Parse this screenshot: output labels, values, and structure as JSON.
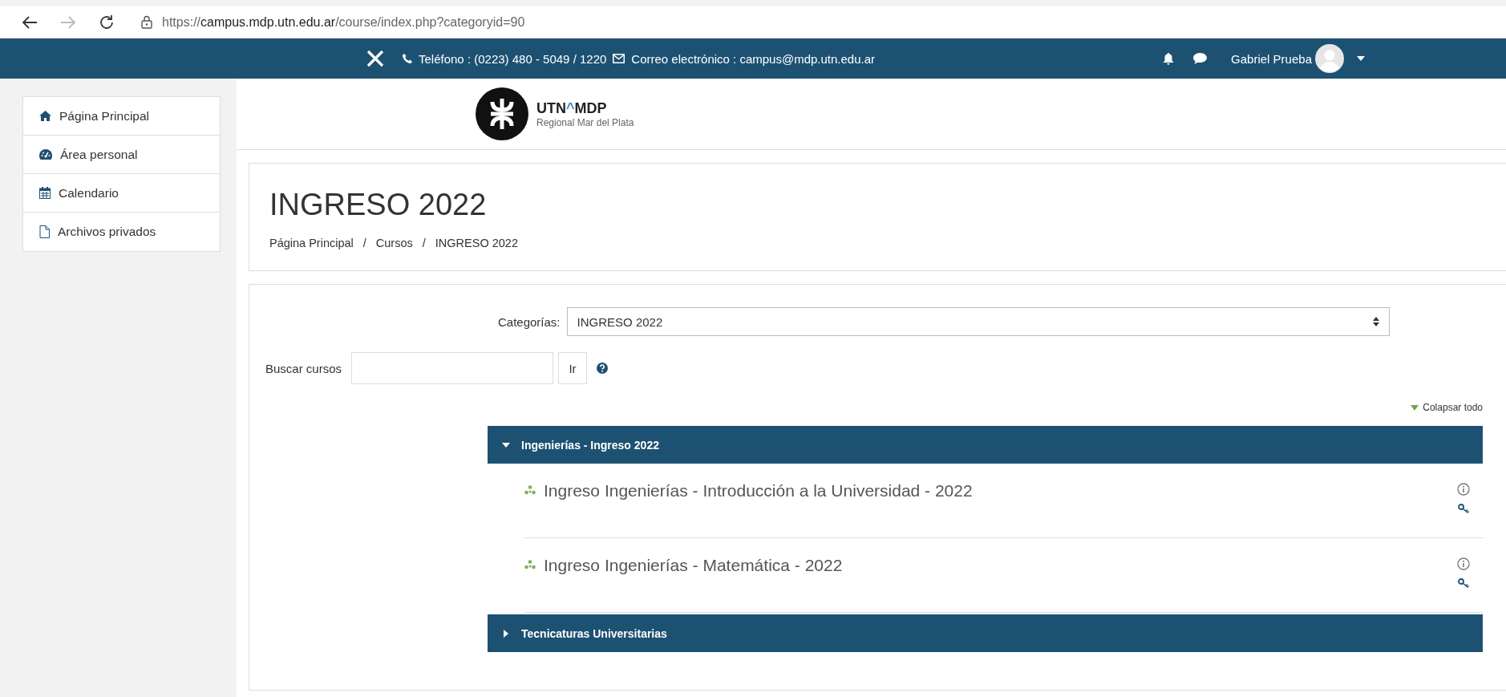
{
  "browser": {
    "url": {
      "prefix": "https://",
      "host": "campus.mdp.utn.edu.ar",
      "path": "/course/index.php?categoryid=90"
    }
  },
  "navbar": {
    "phone": "Teléfono : (0223) 480 - 5049 / 1220",
    "email": "Correo electrónico : campus@mdp.utn.edu.ar",
    "user": "Gabriel Prueba"
  },
  "sidebar": {
    "items": [
      {
        "label": "Página Principal",
        "kind": "home"
      },
      {
        "label": "Área personal",
        "kind": "dashboard"
      },
      {
        "label": "Calendario",
        "kind": "calendar"
      },
      {
        "label": "Archivos privados",
        "kind": "file"
      }
    ]
  },
  "logo": {
    "left": "UTN",
    "mark": "^",
    "right": "MDP",
    "subtitle": "Regional Mar del Plata"
  },
  "header": {
    "title": "INGRESO 2022",
    "breadcrumb": [
      "Página Principal",
      "Cursos",
      "INGRESO 2022"
    ],
    "separator": "/"
  },
  "category_select": {
    "label": "Categorías:",
    "value": "INGRESO 2022"
  },
  "search": {
    "label": "Buscar cursos",
    "button": "Ir"
  },
  "collapse_link": "Colapsar todo",
  "categories": [
    {
      "name": "Ingenierías - Ingreso 2022",
      "expanded": true,
      "courses": [
        {
          "name": "Ingreso Ingenierías - Introducción a la Universidad - 2022"
        },
        {
          "name": "Ingreso Ingenierías - Matemática - 2022"
        }
      ]
    },
    {
      "name": "Tecnicaturas Universitarias",
      "expanded": false
    }
  ]
}
